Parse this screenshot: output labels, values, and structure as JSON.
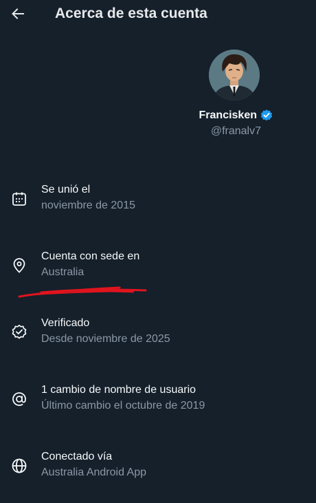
{
  "header": {
    "title": "Acerca de esta cuenta"
  },
  "profile": {
    "display_name": "Francisken",
    "handle": "@franalv7",
    "verified_color": "#1d9bf0"
  },
  "items": [
    {
      "icon": "calendar-icon",
      "title": "Se unió el",
      "subtitle": "noviembre de 2015"
    },
    {
      "icon": "location-pin-icon",
      "title": "Cuenta con sede en",
      "subtitle": "Australia"
    },
    {
      "icon": "verified-badge-icon",
      "title": "Verificado",
      "subtitle": "Desde noviembre de 2025"
    },
    {
      "icon": "at-sign-icon",
      "title": "1 cambio de nombre de usuario",
      "subtitle": "Último cambio el octubre de 2019"
    },
    {
      "icon": "globe-icon",
      "title": "Conectado vía",
      "subtitle": "Australia Android App"
    }
  ],
  "colors": {
    "background": "#15202b",
    "text_primary": "#f7f9f9",
    "text_secondary": "#8b98a5",
    "annotation": "#e0141e"
  }
}
